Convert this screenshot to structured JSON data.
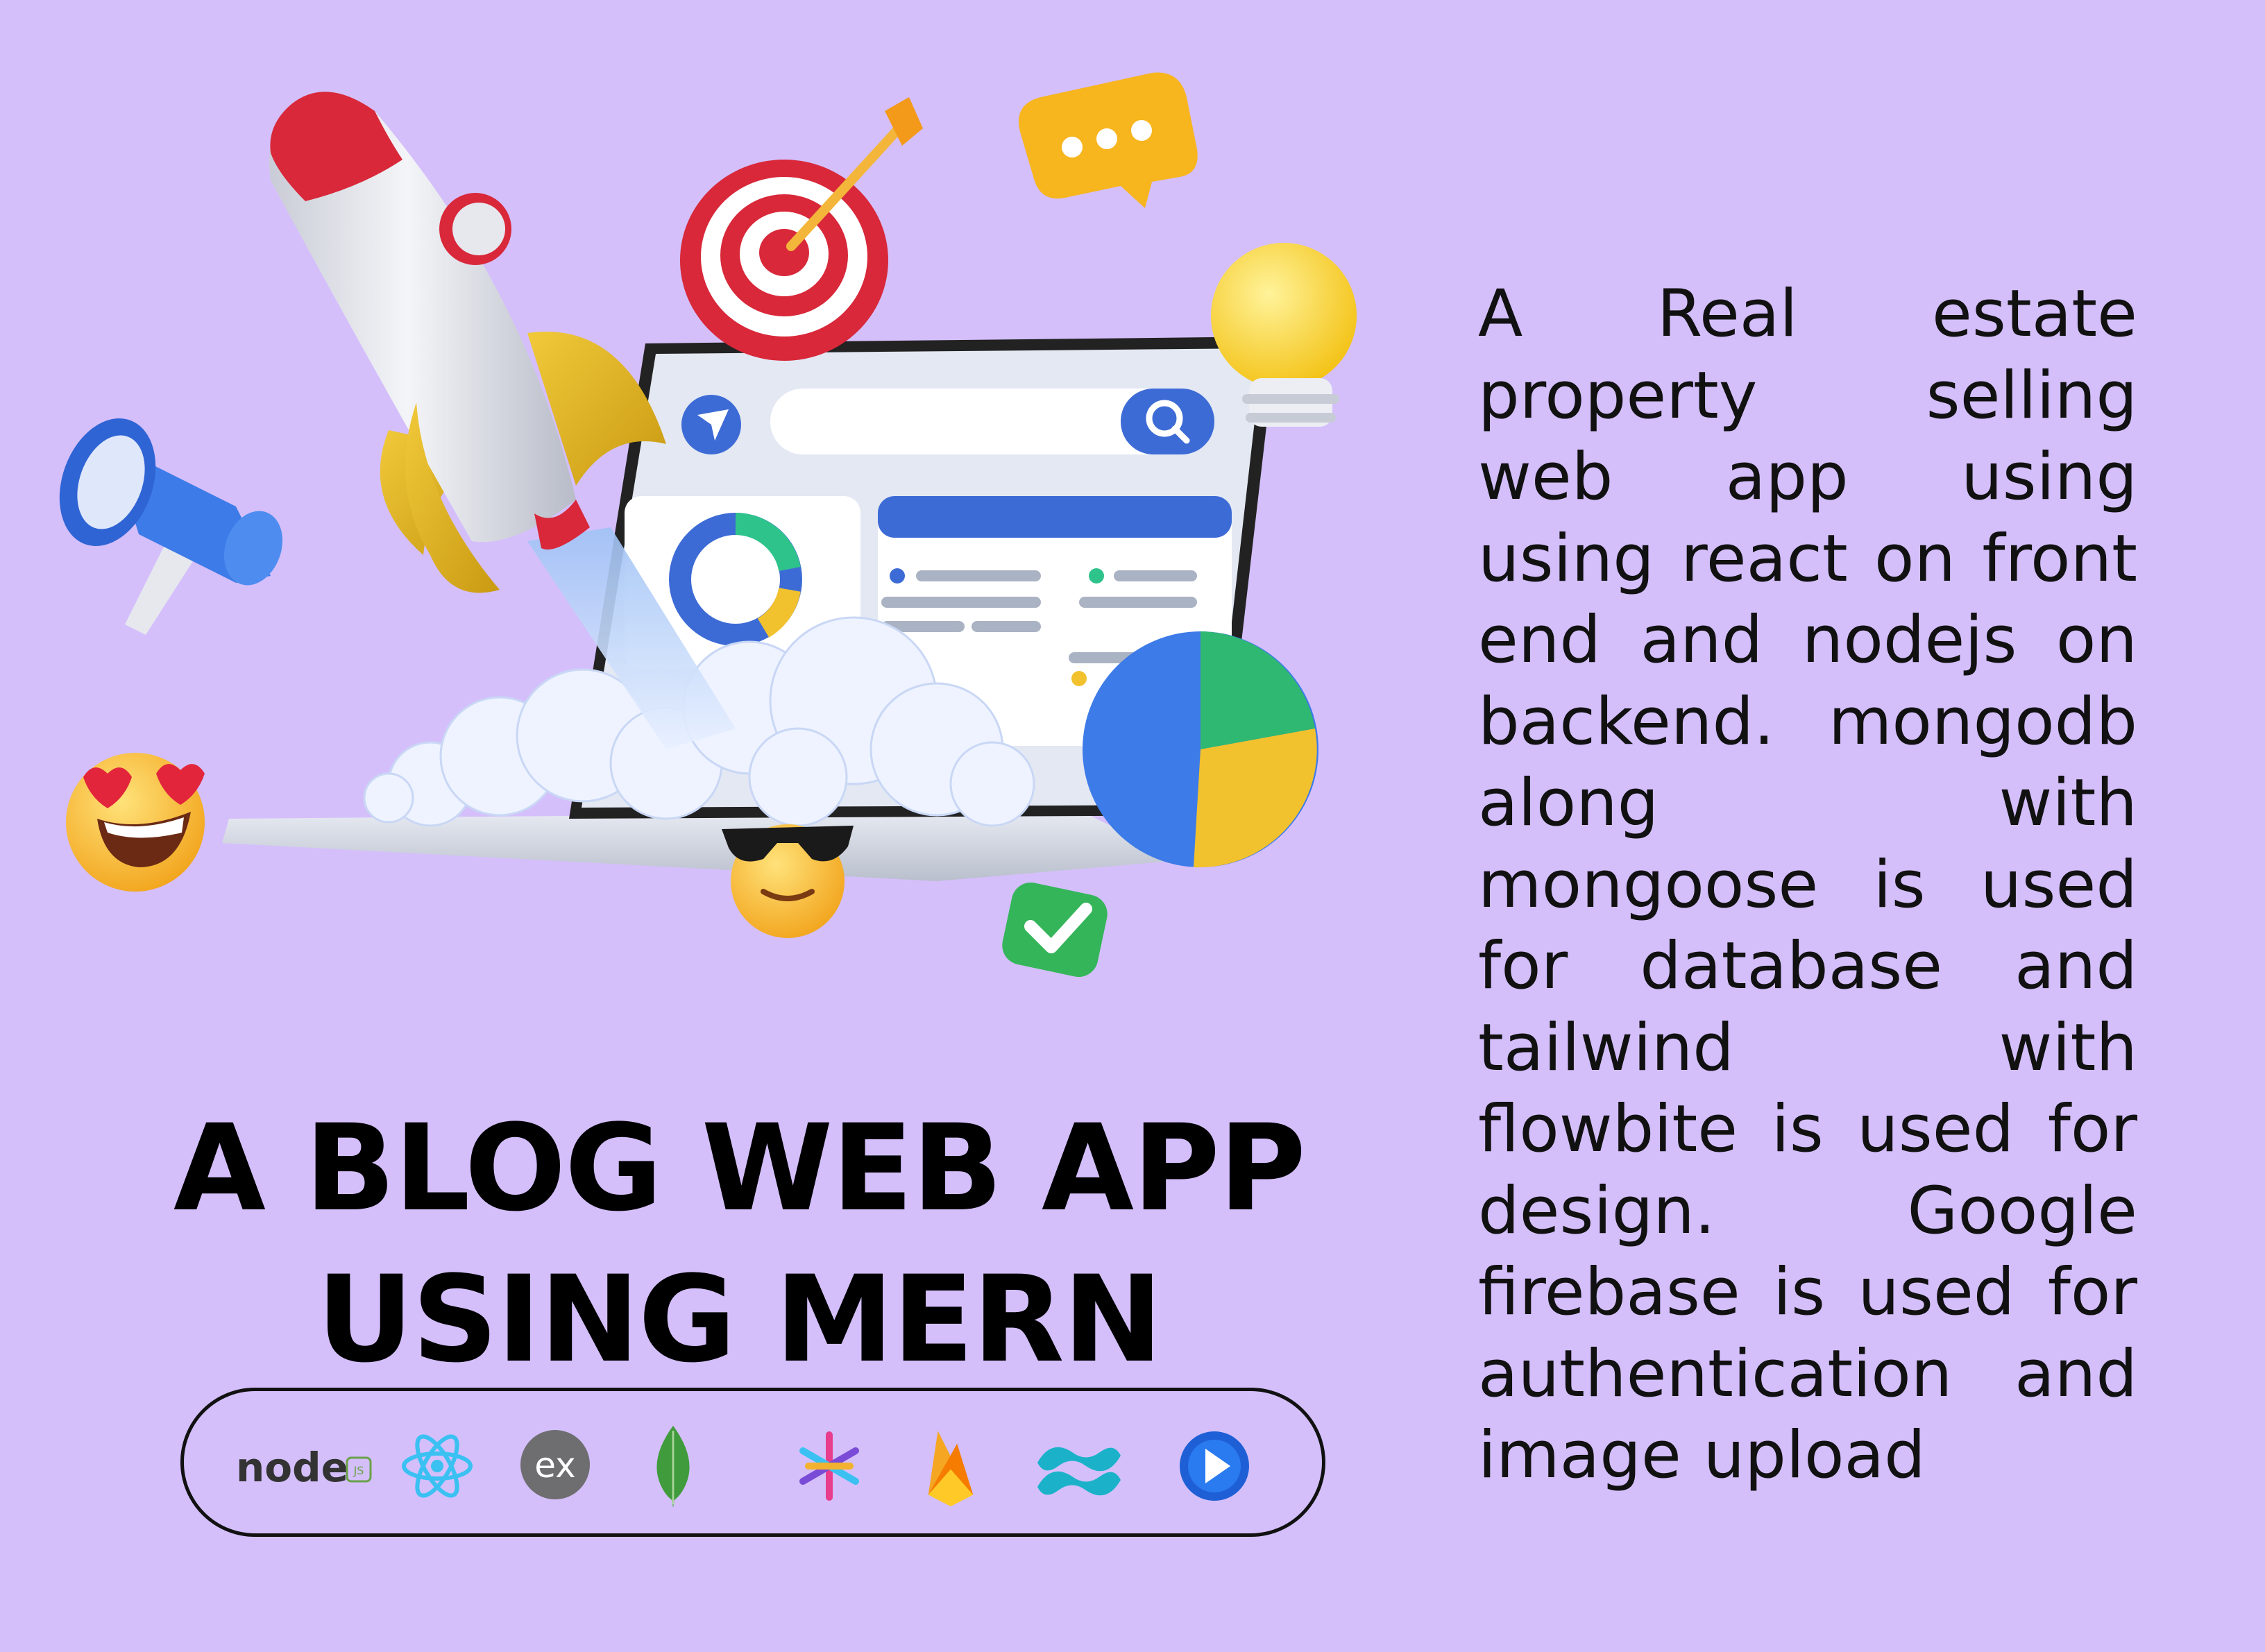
{
  "headline": {
    "line1": "A BLOG WEB APP",
    "line2": "USING MERN"
  },
  "description": "A Real estate property selling web app using using react on front end and nodejs on backend. mongodb along with mongoose is used for database and tailwind with flowbite is used for design. Google firebase is used for authentication and image upload",
  "tech_stack": [
    {
      "name": "nodejs",
      "label": "node",
      "sub": "JS",
      "icon": "nodejs-icon"
    },
    {
      "name": "react",
      "icon": "react-icon"
    },
    {
      "name": "express",
      "label": "ex",
      "icon": "express-icon"
    },
    {
      "name": "mongodb",
      "icon": "mongodb-icon"
    },
    {
      "name": "mongoose",
      "icon": "asterisk-icon"
    },
    {
      "name": "firebase",
      "icon": "firebase-icon"
    },
    {
      "name": "tailwind",
      "icon": "tailwind-icon"
    },
    {
      "name": "flowbite",
      "icon": "flowbite-icon"
    }
  ],
  "colors": {
    "background": "#d4bffb",
    "text": "#000000",
    "accent_blue": "#3d6bd6",
    "rocket_red": "#d8283a",
    "yellow": "#f6c21c"
  }
}
